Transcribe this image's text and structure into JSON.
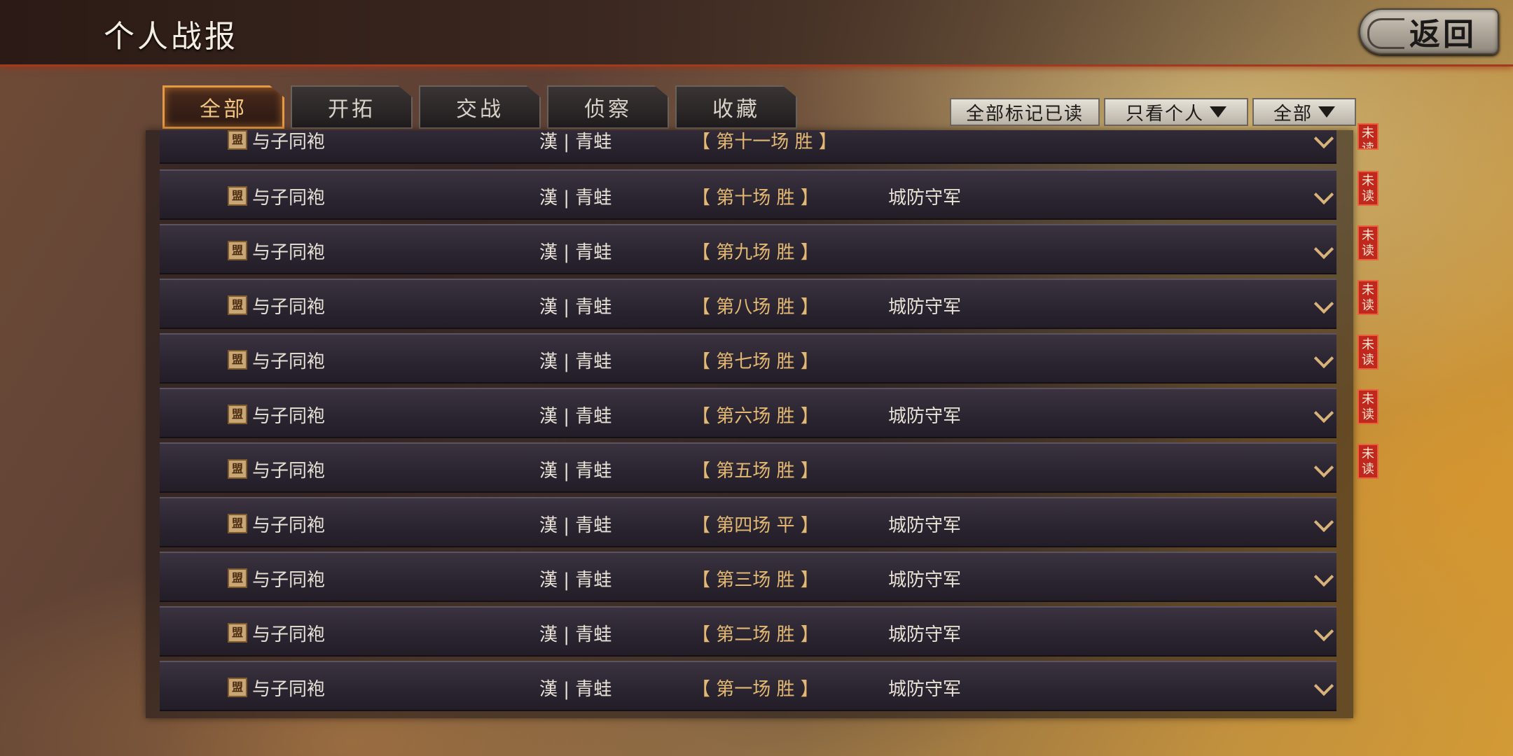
{
  "header": {
    "title": "个人战报",
    "back_label": "返回"
  },
  "tabs": [
    {
      "label": "全部",
      "active": true
    },
    {
      "label": "开拓",
      "active": false
    },
    {
      "label": "交战",
      "active": false
    },
    {
      "label": "侦察",
      "active": false
    },
    {
      "label": "收藏",
      "active": false
    }
  ],
  "toolbar": {
    "mark_all_read": "全部标记已读",
    "filter_personal": "只看个人",
    "filter_all": "全部"
  },
  "list": {
    "partial_row": {
      "name": "与子同袍",
      "country": "漢 | 青蛙",
      "battle": "【 第十一场 胜 】",
      "opponent": "",
      "unread": true
    },
    "rows": [
      {
        "name": "与子同袍",
        "country": "漢 | 青蛙",
        "battle": "【 第十场 胜 】",
        "opponent": "城防守军",
        "unread": true
      },
      {
        "name": "与子同袍",
        "country": "漢 | 青蛙",
        "battle": "【 第九场 胜 】",
        "opponent": "",
        "unread": true
      },
      {
        "name": "与子同袍",
        "country": "漢 | 青蛙",
        "battle": "【 第八场 胜 】",
        "opponent": "城防守军",
        "unread": true
      },
      {
        "name": "与子同袍",
        "country": "漢 | 青蛙",
        "battle": "【 第七场 胜 】",
        "opponent": "",
        "unread": true
      },
      {
        "name": "与子同袍",
        "country": "漢 | 青蛙",
        "battle": "【 第六场 胜 】",
        "opponent": "城防守军",
        "unread": true
      },
      {
        "name": "与子同袍",
        "country": "漢 | 青蛙",
        "battle": "【 第五场 胜 】",
        "opponent": "",
        "unread": true
      },
      {
        "name": "与子同袍",
        "country": "漢 | 青蛙",
        "battle": "【 第四场 平 】",
        "opponent": "城防守军",
        "unread": false
      },
      {
        "name": "与子同袍",
        "country": "漢 | 青蛙",
        "battle": "【 第三场 胜 】",
        "opponent": "城防守军",
        "unread": false
      },
      {
        "name": "与子同袍",
        "country": "漢 | 青蛙",
        "battle": "【 第二场 胜 】",
        "opponent": "城防守军",
        "unread": false
      },
      {
        "name": "与子同袍",
        "country": "漢 | 青蛙",
        "battle": "【 第一场 胜 】",
        "opponent": "城防守军",
        "unread": false
      }
    ]
  },
  "unread_badge": "未读",
  "alliance_icon_glyph": "盟",
  "colors": {
    "active_tab": "#e49a45",
    "unread_badge": "#c0281e",
    "battle_text": "#e3b872"
  }
}
